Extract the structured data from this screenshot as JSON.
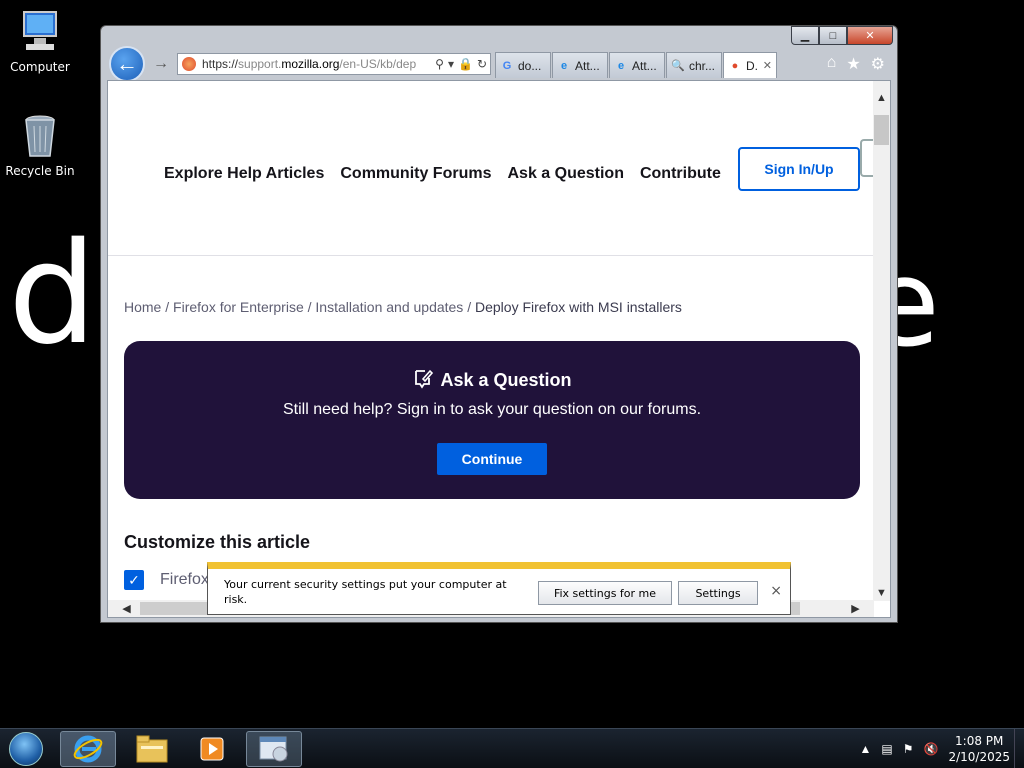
{
  "desktop": {
    "wallpaper_letters": [
      "d",
      "e"
    ],
    "icons": [
      {
        "label": "Computer"
      },
      {
        "label": "Recycle Bin"
      }
    ]
  },
  "browser": {
    "window_buttons": {
      "minimize": "▁",
      "maximize": "□",
      "close": "✕"
    },
    "address": {
      "url_prefix": "https://",
      "url_sub": "support.",
      "url_domain": "mozilla.org",
      "url_path": "/en-US/kb/dep"
    },
    "tabs": [
      {
        "label": "do...",
        "icon": "G"
      },
      {
        "label": "Att...",
        "icon": "e"
      },
      {
        "label": "Att...",
        "icon": "e"
      },
      {
        "label": "chr...",
        "icon": "🔍"
      },
      {
        "label": "D.",
        "icon": "●",
        "active": true
      }
    ],
    "tab_close": "✕"
  },
  "page": {
    "nav": [
      "Explore Help Articles",
      "Community Forums",
      "Ask a Question",
      "Contribute"
    ],
    "signin_label": "Sign In/Up",
    "breadcrumb": {
      "home": "Home",
      "sep": "/",
      "crumb1": "Firefox for Enterprise",
      "crumb2": "Installation and updates",
      "current": "Deploy Firefox with MSI installers"
    },
    "ask_card": {
      "title": "Ask a Question",
      "subtitle": "Still need help? Sign in to ask your question on our forums.",
      "button": "Continue"
    },
    "customize_title": "Customize this article",
    "checkbox_label": "Firefox"
  },
  "notification": {
    "message": "Your current security settings put your computer at risk.",
    "fix_button": "Fix settings for me",
    "settings_button": "Settings",
    "close": "×"
  },
  "taskbar": {
    "time": "1:08 PM",
    "date": "2/10/2025"
  },
  "colors": {
    "accent": "#0060df",
    "card_bg": "#20123a",
    "notif_bar": "#f1c232"
  }
}
